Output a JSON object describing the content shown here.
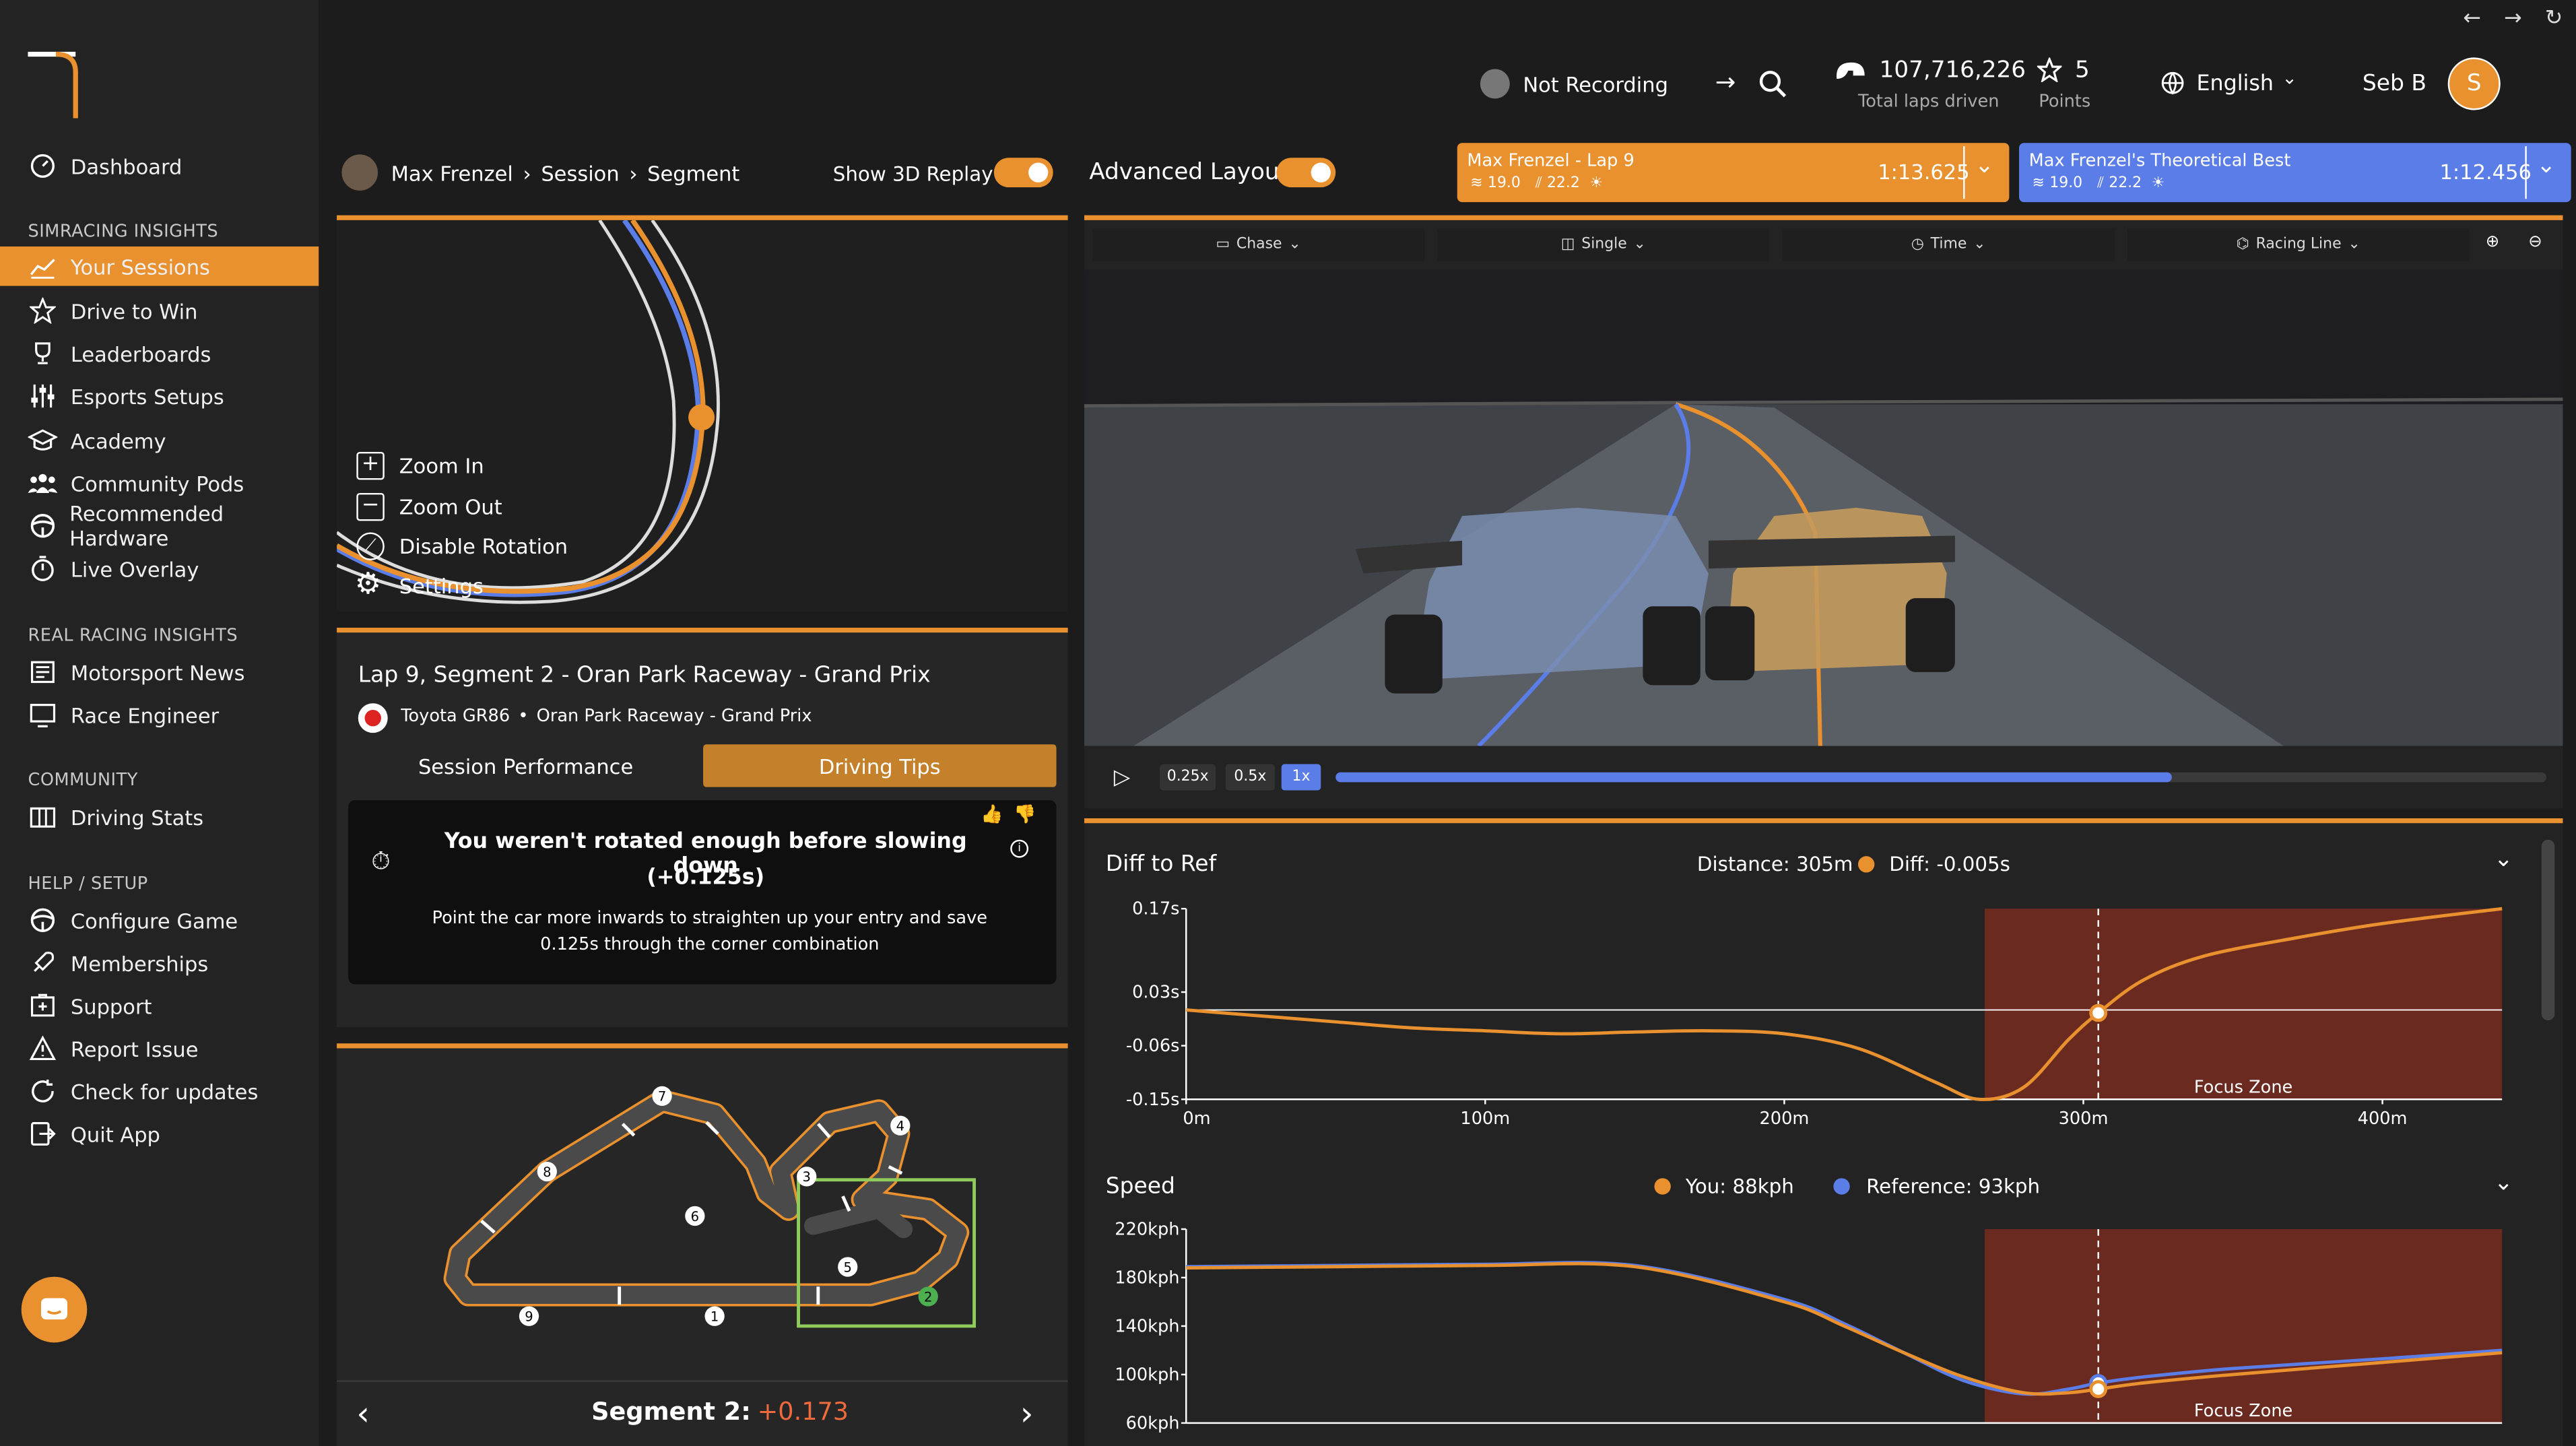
{
  "header": {
    "recording_status": "Not Recording",
    "total_laps": "107,716,226",
    "total_laps_label": "Total laps driven",
    "points": "5",
    "points_label": "Points",
    "language": "English",
    "user_name": "Seb B",
    "avatar_initial": "S"
  },
  "sidebar": {
    "top_item": "Dashboard",
    "section_simracing": "SIMRACING INSIGHTS",
    "simracing_items": [
      "Your Sessions",
      "Drive to Win",
      "Leaderboards",
      "Esports Setups",
      "Academy",
      "Community Pods",
      "Recommended Hardware",
      "Live Overlay"
    ],
    "section_real": "REAL RACING INSIGHTS",
    "real_items": [
      "Motorsport News",
      "Race Engineer"
    ],
    "section_community": "COMMUNITY",
    "community_items": [
      "Driving Stats"
    ],
    "section_help": "HELP / SETUP",
    "help_items": [
      "Configure Game",
      "Memberships",
      "Support",
      "Report Issue",
      "Check for updates",
      "Quit App"
    ]
  },
  "breadcrumb": {
    "driver": "Max Frenzel",
    "session": "Session",
    "segment": "Segment"
  },
  "toggles": {
    "replay_label": "Show 3D Replay",
    "layout_label": "Advanced Layout"
  },
  "lap_cards": {
    "user": {
      "name": "Max Frenzel - Lap 9",
      "time": "1:13.625",
      "air": "19.0",
      "track": "22.2"
    },
    "ref": {
      "name": "Max Frenzel's Theoretical Best",
      "time": "1:12.456",
      "air": "19.0",
      "track": "22.2"
    }
  },
  "mini_map": {
    "zoom_in": "Zoom In",
    "zoom_out": "Zoom Out",
    "disable_rotation": "Disable Rotation",
    "settings": "Settings"
  },
  "lap_info": {
    "title": "Lap 9, Segment 2 - Oran Park Raceway - Grand Prix",
    "car": "Toyota GR86",
    "track": "Oran Park Raceway - Grand Prix",
    "tab_performance": "Session Performance",
    "tab_tips": "Driving Tips"
  },
  "tip": {
    "title": "You weren't rotated enough before slowing down",
    "delta": "(+0.125s)",
    "body": "Point the car more inwards to straighten up your entry and save 0.125s through the corner combination"
  },
  "track_map": {
    "corners": [
      "1",
      "2",
      "3",
      "4",
      "5",
      "6",
      "7",
      "8",
      "9"
    ]
  },
  "segment_nav": {
    "label": "Segment 2:",
    "delta": "+0.173"
  },
  "replay": {
    "camera": "Chase",
    "view": "Single",
    "mode": "Time",
    "line": "Racing Line",
    "speeds": [
      "0.25x",
      "0.5x",
      "1x"
    ],
    "progress": 0.69
  },
  "colors": {
    "accent": "#e8912e",
    "reference": "#5b7de8",
    "focus_zone": "#6b2a20",
    "delta_positive": "#ef6a3c"
  },
  "chart_data": [
    {
      "type": "line",
      "title": "Diff to Ref",
      "readout": {
        "distance": "Distance: 305m",
        "diff": "Diff: -0.005s"
      },
      "x": [
        0,
        25,
        50,
        75,
        100,
        125,
        150,
        175,
        200,
        225,
        250,
        265,
        280,
        295,
        305,
        320,
        340,
        370,
        400,
        440
      ],
      "series": [
        {
          "values": [
            0.0,
            -0.01,
            -0.02,
            -0.03,
            -0.035,
            -0.04,
            -0.037,
            -0.035,
            -0.04,
            -0.065,
            -0.12,
            -0.15,
            -0.13,
            -0.05,
            -0.005,
            0.05,
            0.09,
            0.12,
            0.145,
            0.17
          ]
        }
      ],
      "xlim": [
        0,
        440
      ],
      "ylim": [
        -0.15,
        0.17
      ],
      "yticks": [
        "0.17s",
        "0.03s",
        "-0.06s",
        "-0.15s"
      ],
      "xticks": [
        "0m",
        "100m",
        "200m",
        "300m",
        "400m"
      ],
      "focus_zone": {
        "label": "Focus Zone",
        "start": 267,
        "end": 440
      },
      "cursor": 305,
      "grid": false
    },
    {
      "type": "line",
      "title": "Speed",
      "legend": [
        "You: 88kph",
        "Reference: 93kph"
      ],
      "x": [
        0,
        50,
        100,
        150,
        200,
        220,
        240,
        260,
        280,
        295,
        305,
        320,
        350,
        400,
        440
      ],
      "series": [
        {
          "name": "You: 88kph",
          "values": [
            188,
            189,
            190,
            189,
            160,
            140,
            118,
            98,
            85,
            85,
            88,
            93,
            100,
            110,
            118
          ]
        },
        {
          "name": "Reference: 93kph",
          "values": [
            189,
            190,
            191,
            190,
            162,
            142,
            118,
            95,
            84,
            88,
            93,
            98,
            105,
            113,
            120
          ]
        }
      ],
      "xlim": [
        0,
        440
      ],
      "ylim": [
        60,
        220
      ],
      "yticks": [
        "220kph",
        "180kph",
        "140kph",
        "100kph",
        "60kph"
      ],
      "focus_zone": {
        "label": "Focus Zone",
        "start": 267,
        "end": 440
      },
      "cursor": 305,
      "grid": false
    }
  ]
}
